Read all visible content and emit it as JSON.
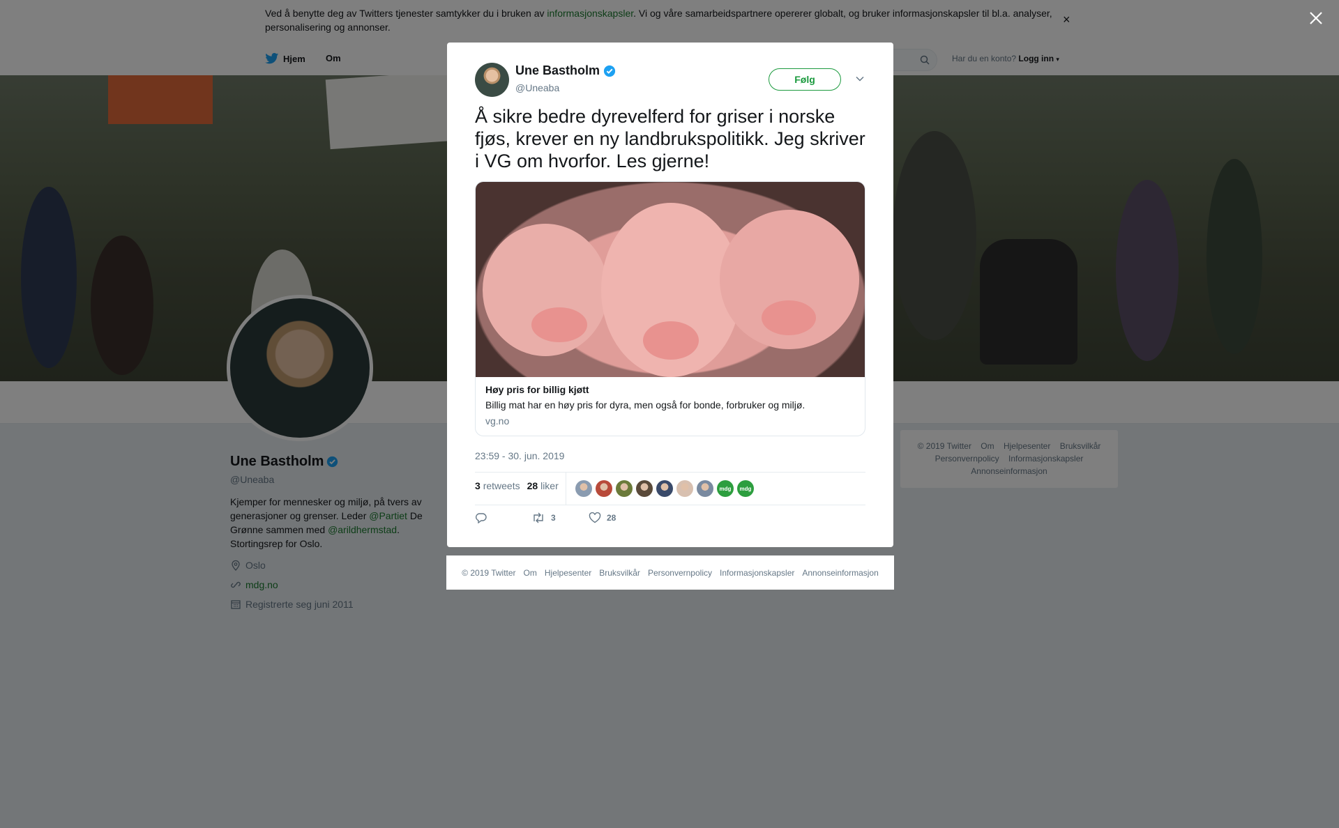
{
  "cookie": {
    "text_before": "Ved å benytte deg av Twitters tjenester samtykker du i bruken av ",
    "link": "informasjonskapsler",
    "text_after": ". Vi og våre samarbeidspartnere opererer globalt, og bruker informasjonskapsler til bl.a. analyser, personalisering og annonser.",
    "close": "×"
  },
  "nav": {
    "home": "Hjem",
    "about": "Om",
    "account_prompt": "Har du en konto?",
    "login": "Logg inn"
  },
  "profile": {
    "name": "Une Bastholm",
    "handle": "@Uneaba",
    "bio_1": "Kjemper for mennesker og miljø, på tvers av generasjoner og grenser. Leder ",
    "bio_link_1": "@Partiet",
    "bio_2": " De Grønne sammen med ",
    "bio_link_2": "@arildhermstad",
    "bio_3": ". Stortingsrep for Oslo.",
    "location": "Oslo",
    "website": "mdg.no",
    "joined": "Registrerte seg juni 2011"
  },
  "side_footer": {
    "items_row1": [
      "© 2019 Twitter",
      "Om",
      "Hjelpesenter",
      "Bruksvilkår"
    ],
    "items_row2": [
      "Personvernpolicy",
      "Informasjonskapsler"
    ],
    "items_row3": [
      "Annonseinformasjon"
    ]
  },
  "tweet": {
    "name": "Une Bastholm",
    "handle": "@Uneaba",
    "follow": "Følg",
    "text": "Å sikre bedre dyrevelferd for griser i norske fjøs, krever en ny landbrukspolitikk. Jeg skriver i VG om hvorfor. Les gjerne!",
    "card_title": "Høy pris for billig kjøtt",
    "card_desc": "Billig mat har en høy pris for dyra, men også for bonde, forbruker og miljø.",
    "card_domain": "vg.no",
    "timestamp": "23:59 - 30. jun. 2019",
    "retweets_count": "3",
    "retweets_label": "retweets",
    "likes_count": "28",
    "likes_label": "liker",
    "action_retweets": "3",
    "action_likes": "28",
    "likers": [
      "#8a9bb0",
      "#b84a3a",
      "#6b7a3a",
      "#5a4a3a",
      "#3a4a6a",
      "#d8c0b0",
      "#7a8aa0",
      "mdg",
      "mdg"
    ]
  },
  "bottom_footer": [
    "© 2019 Twitter",
    "Om",
    "Hjelpesenter",
    "Bruksvilkår",
    "Personvernpolicy",
    "Informasjonskapsler",
    "Annonseinformasjon"
  ],
  "colors": {
    "accent": "#1b9a3e",
    "verified": "#1da1f2",
    "link": "#1b7a2e"
  },
  "icons": [
    "twitter-bird-icon",
    "search-icon",
    "verified-icon",
    "location-icon",
    "link-icon",
    "calendar-icon",
    "chevron-down-icon",
    "reply-icon",
    "retweet-icon",
    "like-icon",
    "close-icon"
  ]
}
